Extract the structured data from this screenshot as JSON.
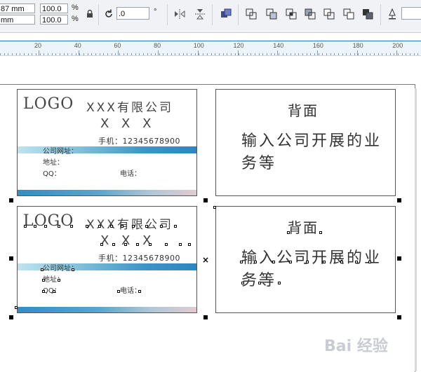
{
  "propbar": {
    "width_value": "87 mm",
    "height_value": "mm",
    "scale_x": "100.0",
    "scale_y": "100.0",
    "percent": "%",
    "rotation": ".0",
    "degree": "°"
  },
  "ruler": {
    "marks": [
      "20",
      "40",
      "60",
      "80",
      "100",
      "120",
      "140",
      "160",
      "180",
      "200"
    ]
  },
  "card_front": {
    "logo": "LOGO",
    "company": "XXX有限公司",
    "name": "X X X",
    "phone": "手机：12345678900",
    "website": "公司网址：",
    "address": "地址：",
    "qq": "QQ：",
    "tel": "电话："
  },
  "card_back": {
    "title": "背面",
    "body": "输入公司开展的业务等"
  },
  "watermark": "Bai 经验"
}
